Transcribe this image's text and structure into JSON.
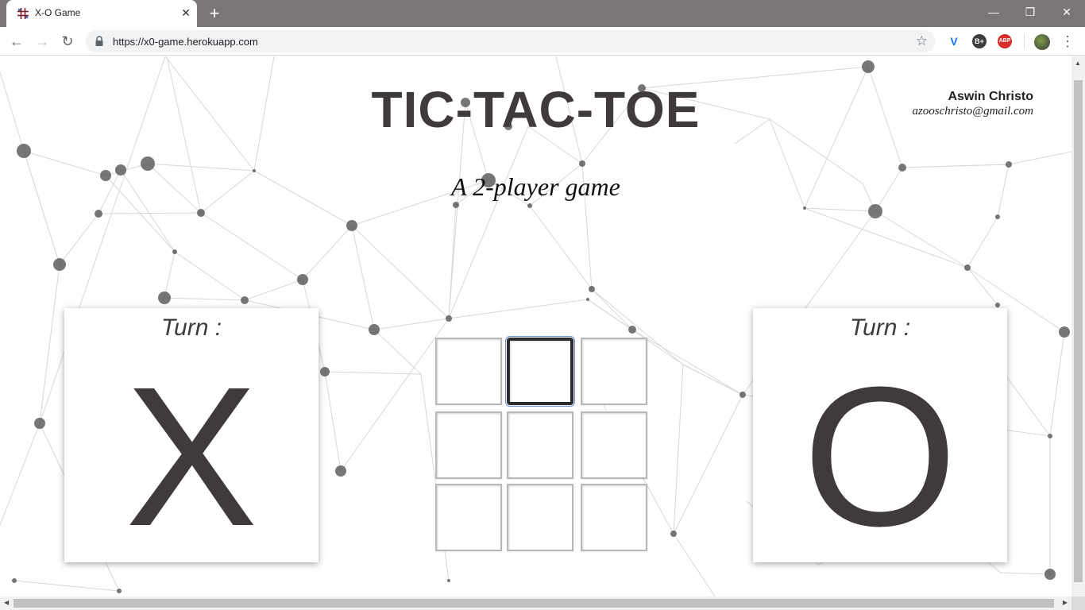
{
  "browser": {
    "tab_title": "X-O Game",
    "tab_close": "✕",
    "new_tab": "+",
    "url": "https://x0-game.herokuapp.com",
    "window_minimize": "—",
    "window_restore": "❐",
    "window_close": "✕",
    "nav_back": "←",
    "nav_forward": "→",
    "nav_reload": "↻",
    "bookmark_star": "☆",
    "extensions": [
      {
        "name": "v-extension-icon",
        "label": "V"
      },
      {
        "name": "b-plus-extension-icon",
        "label": "B+"
      },
      {
        "name": "adblock-plus-icon",
        "label": "ABP"
      }
    ],
    "menu": "⋮"
  },
  "page": {
    "title": "TIC-TAC-TOE",
    "subtitle": "A 2-player game",
    "author": {
      "name": "Aswin Christo",
      "email": "azooschristo@gmail.com"
    },
    "player_x": {
      "turn_label": "Turn :",
      "mark": "X"
    },
    "player_o": {
      "turn_label": "Turn :",
      "mark": "O"
    },
    "board": {
      "cells": [
        "",
        "",
        "",
        "",
        "",
        "",
        "",
        "",
        ""
      ],
      "focused_cell": 1
    }
  },
  "colors": {
    "text_dark": "#3f3a3b",
    "tabstrip": "#7a7677",
    "focus_outline": "#6a8fd8"
  }
}
